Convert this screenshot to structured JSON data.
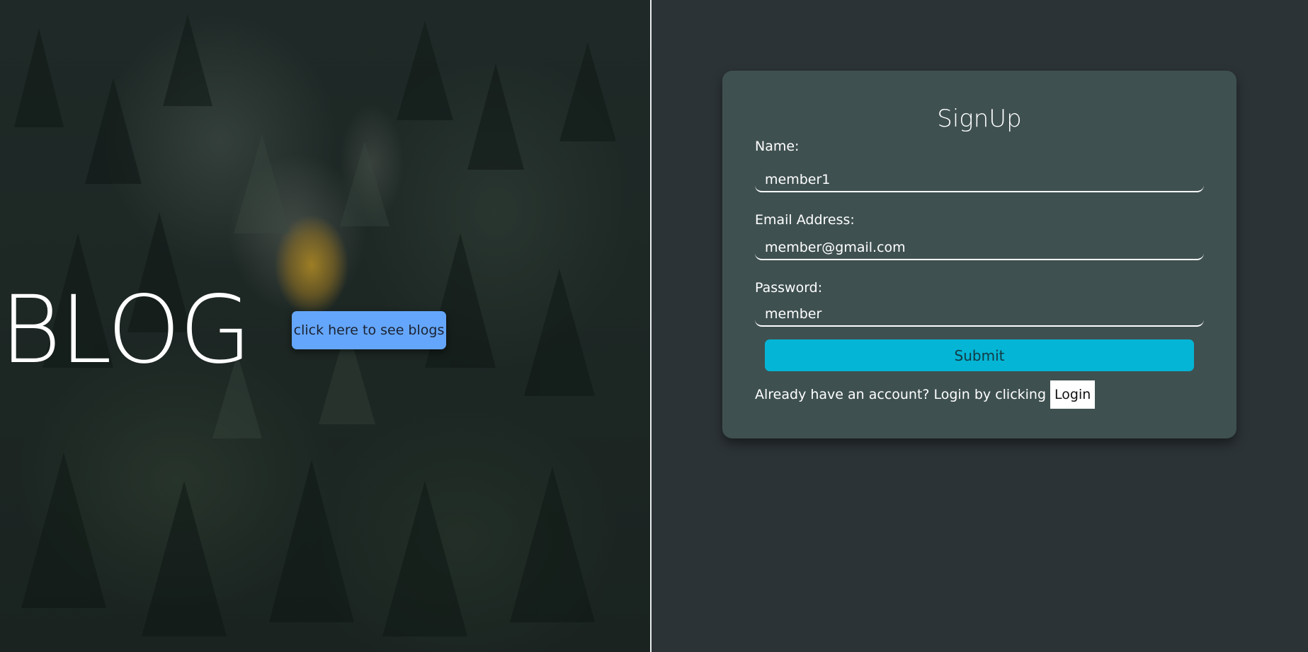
{
  "hero": {
    "title": "BLOG",
    "button_label": "click here to see blogs"
  },
  "signup": {
    "title": "SignUp",
    "name_label": "Name:",
    "name_value": "member1",
    "email_label": "Email Address:",
    "email_value": "member@gmail.com",
    "password_label": "Password:",
    "password_value": "member",
    "submit_label": "Submit",
    "login_prompt": "Already have an account? Login by clicking",
    "login_label": "Login"
  },
  "colors": {
    "page_background": "#2c3337",
    "card_background": "#3f5050",
    "blog_button": "#64a6fb",
    "submit_button": "#05b5d5",
    "login_button": "#ffffff"
  }
}
